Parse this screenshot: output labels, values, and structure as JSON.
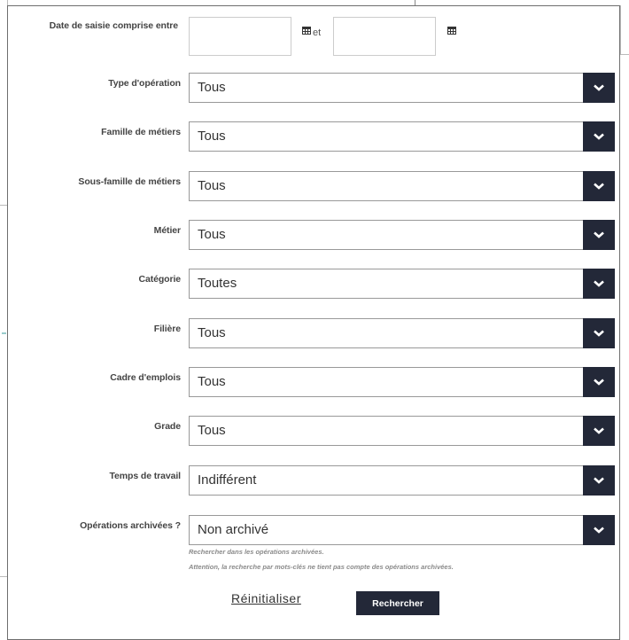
{
  "date_range": {
    "label": "Date de saisie comprise entre",
    "start_value": "",
    "separator": "et",
    "end_value": ""
  },
  "filters": [
    {
      "label": "Type d'opération",
      "value": "Tous"
    },
    {
      "label": "Famille de métiers",
      "value": "Tous"
    },
    {
      "label": "Sous-famille de métiers",
      "value": "Tous"
    },
    {
      "label": "Métier",
      "value": "Tous"
    },
    {
      "label": "Catégorie",
      "value": "Toutes"
    },
    {
      "label": "Filière",
      "value": "Tous"
    },
    {
      "label": "Cadre d'emplois",
      "value": "Tous"
    },
    {
      "label": "Grade",
      "value": "Tous"
    },
    {
      "label": "Temps de travail",
      "value": "Indifférent"
    },
    {
      "label": "Opérations archivées ?",
      "value": "Non archivé"
    }
  ],
  "help": {
    "line1": "Rechercher dans les opérations archivées.",
    "line2": "Attention, la recherche par mots-clés ne tient pas compte des opérations archivées."
  },
  "actions": {
    "reset_label": "Réinitialiser",
    "search_label": "Rechercher"
  },
  "icons": {
    "calendar": "calendar-icon",
    "dropdown": "chevron-down-icon"
  },
  "colors": {
    "dark_button": "#232838",
    "border": "#999999"
  }
}
